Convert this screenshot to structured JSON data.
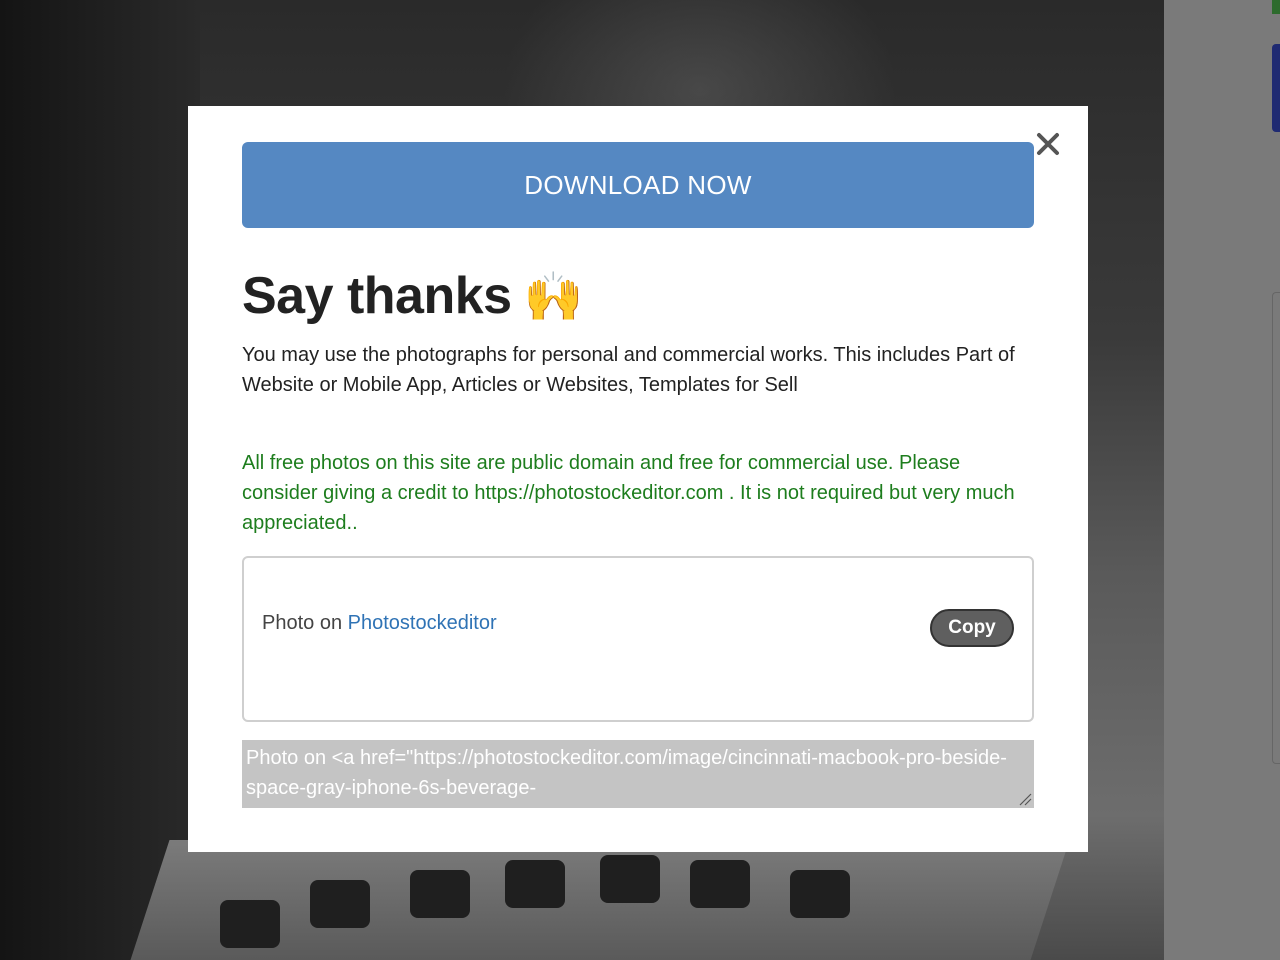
{
  "modal": {
    "close_icon": "close-icon",
    "download_label": "DOWNLOAD NOW",
    "title": "Say thanks",
    "title_emoji": "🙌",
    "description": "You may use the photographs for personal and commercial works. This includes Part of Website or Mobile App, Articles or Websites, Templates for Sell",
    "credit_note": "All free photos on this site are public domain and free for commercial use. Please consider giving a credit to https://photostockeditor.com . It is not required but very much appreciated..",
    "attribution": {
      "prefix": "Photo on",
      "link_text": "Photostockeditor",
      "copy_label": "Copy"
    },
    "code_snippet": "Photo on <a href=\"https://photostockeditor.com/image/cincinnati-macbook-pro-beside-space-gray-iphone-6s-beverage-"
  },
  "colors": {
    "download_button": "#5588c2",
    "credit_text": "#1d7d1d",
    "link": "#2f73b5",
    "code_background": "#c4c4c4"
  }
}
